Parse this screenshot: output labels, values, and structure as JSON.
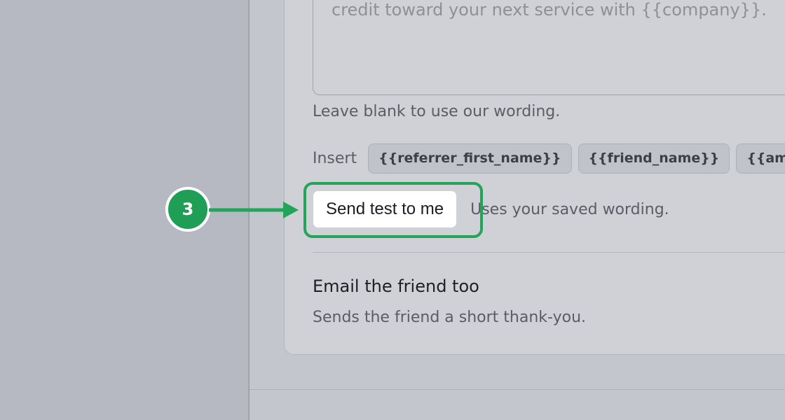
{
  "editor": {
    "textarea_text": "credit toward your next service with {{company}}.",
    "hint": "Leave blank to use our wording.",
    "insert_label": "Insert",
    "tokens": [
      "{{referrer_first_name}}",
      "{{friend_name}}",
      "{{am"
    ]
  },
  "test": {
    "button_label": "Send test to me",
    "caption": "Uses your saved wording."
  },
  "friend_email": {
    "title": "Email the friend too",
    "description": "Sends the friend a short thank-you."
  },
  "callout": {
    "step": "3",
    "color": "#22a559"
  }
}
